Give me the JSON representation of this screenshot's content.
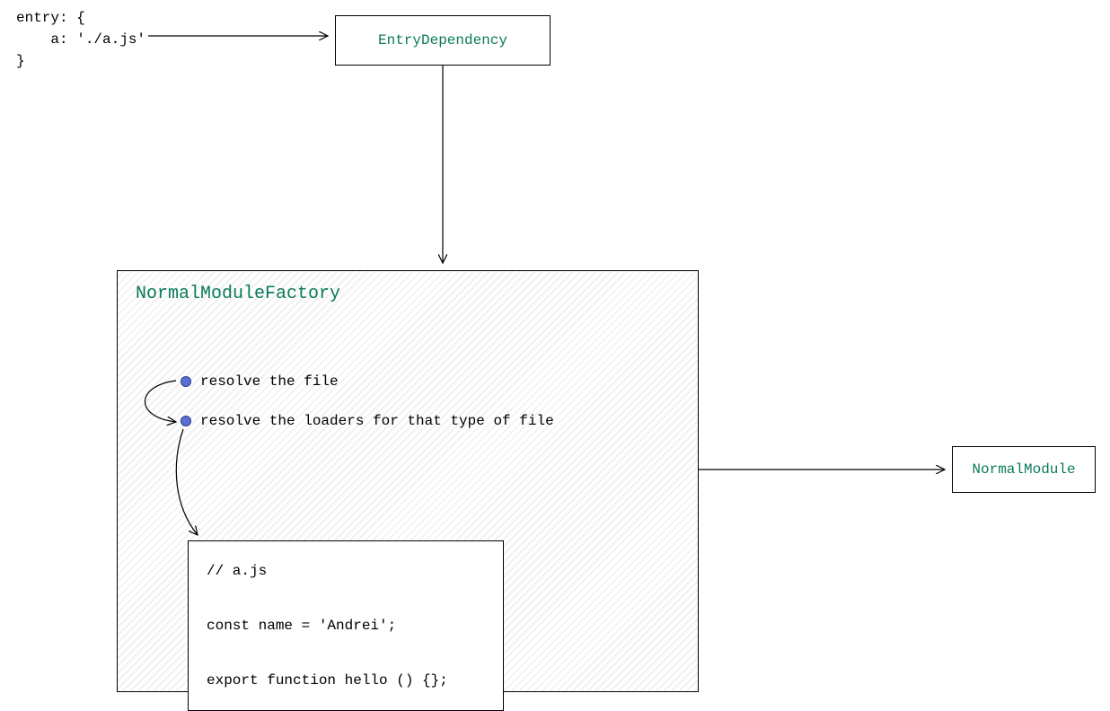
{
  "entry_code": "entry: {\n    a: './a.js'\n}",
  "entry_dependency_label": "EntryDependency",
  "factory_title": "NormalModuleFactory",
  "bullet1": "resolve the file",
  "bullet2": "resolve the loaders for that type of file",
  "inner_code": "// a.js\n\nconst name = 'Andrei';\n\nexport function hello () {};",
  "normal_module_label": "NormalModule",
  "colors": {
    "green": "#0a7a5a",
    "bullet_fill": "#5b6fd6",
    "bullet_stroke": "#2a3a8a"
  }
}
